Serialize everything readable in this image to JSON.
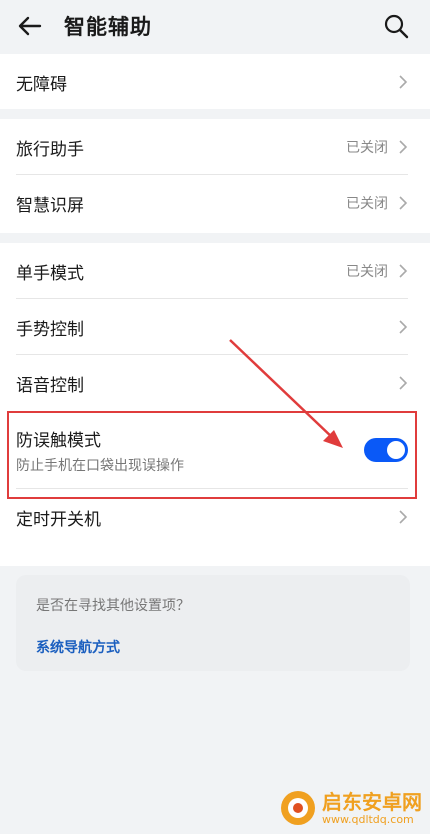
{
  "header": {
    "title": "智能辅助"
  },
  "groups": {
    "g1": [
      {
        "label": "无障碍",
        "value": ""
      }
    ],
    "g2": [
      {
        "label": "旅行助手",
        "value": "已关闭"
      },
      {
        "label": "智慧识屏",
        "value": "已关闭"
      }
    ],
    "g3": [
      {
        "label": "单手模式",
        "value": "已关闭"
      },
      {
        "label": "手势控制",
        "value": ""
      },
      {
        "label": "语音控制",
        "value": ""
      }
    ]
  },
  "toggle_item": {
    "label": "防误触模式",
    "sub": "防止手机在口袋出现误操作",
    "enabled": true
  },
  "timer_item": {
    "label": "定时开关机"
  },
  "suggest": {
    "question": "是否在寻找其他设置项？",
    "link": "系统导航方式"
  },
  "watermark": {
    "name": "启东安卓网",
    "url": "www.qdltdq.com"
  },
  "colors": {
    "accent": "#0a59f7",
    "highlight": "#e03c3c",
    "link": "#1b5fbf"
  }
}
